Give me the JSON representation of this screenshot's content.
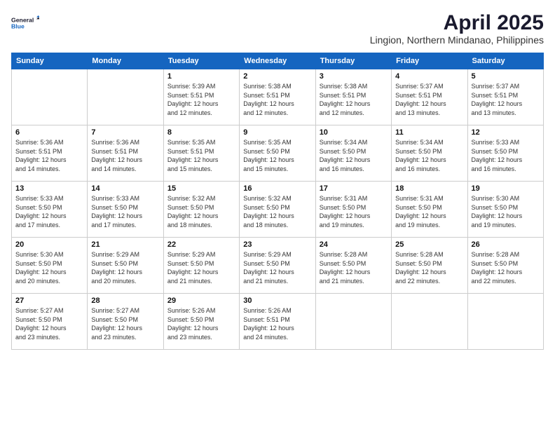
{
  "logo": {
    "line1": "General",
    "line2": "Blue"
  },
  "title": "April 2025",
  "subtitle": "Lingion, Northern Mindanao, Philippines",
  "days_header": [
    "Sunday",
    "Monday",
    "Tuesday",
    "Wednesday",
    "Thursday",
    "Friday",
    "Saturday"
  ],
  "weeks": [
    [
      {
        "num": "",
        "info": ""
      },
      {
        "num": "",
        "info": ""
      },
      {
        "num": "1",
        "info": "Sunrise: 5:39 AM\nSunset: 5:51 PM\nDaylight: 12 hours\nand 12 minutes."
      },
      {
        "num": "2",
        "info": "Sunrise: 5:38 AM\nSunset: 5:51 PM\nDaylight: 12 hours\nand 12 minutes."
      },
      {
        "num": "3",
        "info": "Sunrise: 5:38 AM\nSunset: 5:51 PM\nDaylight: 12 hours\nand 12 minutes."
      },
      {
        "num": "4",
        "info": "Sunrise: 5:37 AM\nSunset: 5:51 PM\nDaylight: 12 hours\nand 13 minutes."
      },
      {
        "num": "5",
        "info": "Sunrise: 5:37 AM\nSunset: 5:51 PM\nDaylight: 12 hours\nand 13 minutes."
      }
    ],
    [
      {
        "num": "6",
        "info": "Sunrise: 5:36 AM\nSunset: 5:51 PM\nDaylight: 12 hours\nand 14 minutes."
      },
      {
        "num": "7",
        "info": "Sunrise: 5:36 AM\nSunset: 5:51 PM\nDaylight: 12 hours\nand 14 minutes."
      },
      {
        "num": "8",
        "info": "Sunrise: 5:35 AM\nSunset: 5:51 PM\nDaylight: 12 hours\nand 15 minutes."
      },
      {
        "num": "9",
        "info": "Sunrise: 5:35 AM\nSunset: 5:50 PM\nDaylight: 12 hours\nand 15 minutes."
      },
      {
        "num": "10",
        "info": "Sunrise: 5:34 AM\nSunset: 5:50 PM\nDaylight: 12 hours\nand 16 minutes."
      },
      {
        "num": "11",
        "info": "Sunrise: 5:34 AM\nSunset: 5:50 PM\nDaylight: 12 hours\nand 16 minutes."
      },
      {
        "num": "12",
        "info": "Sunrise: 5:33 AM\nSunset: 5:50 PM\nDaylight: 12 hours\nand 16 minutes."
      }
    ],
    [
      {
        "num": "13",
        "info": "Sunrise: 5:33 AM\nSunset: 5:50 PM\nDaylight: 12 hours\nand 17 minutes."
      },
      {
        "num": "14",
        "info": "Sunrise: 5:33 AM\nSunset: 5:50 PM\nDaylight: 12 hours\nand 17 minutes."
      },
      {
        "num": "15",
        "info": "Sunrise: 5:32 AM\nSunset: 5:50 PM\nDaylight: 12 hours\nand 18 minutes."
      },
      {
        "num": "16",
        "info": "Sunrise: 5:32 AM\nSunset: 5:50 PM\nDaylight: 12 hours\nand 18 minutes."
      },
      {
        "num": "17",
        "info": "Sunrise: 5:31 AM\nSunset: 5:50 PM\nDaylight: 12 hours\nand 19 minutes."
      },
      {
        "num": "18",
        "info": "Sunrise: 5:31 AM\nSunset: 5:50 PM\nDaylight: 12 hours\nand 19 minutes."
      },
      {
        "num": "19",
        "info": "Sunrise: 5:30 AM\nSunset: 5:50 PM\nDaylight: 12 hours\nand 19 minutes."
      }
    ],
    [
      {
        "num": "20",
        "info": "Sunrise: 5:30 AM\nSunset: 5:50 PM\nDaylight: 12 hours\nand 20 minutes."
      },
      {
        "num": "21",
        "info": "Sunrise: 5:29 AM\nSunset: 5:50 PM\nDaylight: 12 hours\nand 20 minutes."
      },
      {
        "num": "22",
        "info": "Sunrise: 5:29 AM\nSunset: 5:50 PM\nDaylight: 12 hours\nand 21 minutes."
      },
      {
        "num": "23",
        "info": "Sunrise: 5:29 AM\nSunset: 5:50 PM\nDaylight: 12 hours\nand 21 minutes."
      },
      {
        "num": "24",
        "info": "Sunrise: 5:28 AM\nSunset: 5:50 PM\nDaylight: 12 hours\nand 21 minutes."
      },
      {
        "num": "25",
        "info": "Sunrise: 5:28 AM\nSunset: 5:50 PM\nDaylight: 12 hours\nand 22 minutes."
      },
      {
        "num": "26",
        "info": "Sunrise: 5:28 AM\nSunset: 5:50 PM\nDaylight: 12 hours\nand 22 minutes."
      }
    ],
    [
      {
        "num": "27",
        "info": "Sunrise: 5:27 AM\nSunset: 5:50 PM\nDaylight: 12 hours\nand 23 minutes."
      },
      {
        "num": "28",
        "info": "Sunrise: 5:27 AM\nSunset: 5:50 PM\nDaylight: 12 hours\nand 23 minutes."
      },
      {
        "num": "29",
        "info": "Sunrise: 5:26 AM\nSunset: 5:50 PM\nDaylight: 12 hours\nand 23 minutes."
      },
      {
        "num": "30",
        "info": "Sunrise: 5:26 AM\nSunset: 5:51 PM\nDaylight: 12 hours\nand 24 minutes."
      },
      {
        "num": "",
        "info": ""
      },
      {
        "num": "",
        "info": ""
      },
      {
        "num": "",
        "info": ""
      }
    ]
  ]
}
